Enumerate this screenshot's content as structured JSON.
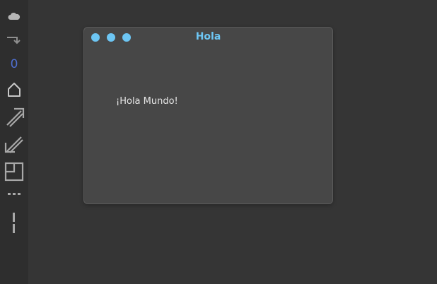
{
  "sidebar": {
    "icons": [
      "cloud-icon",
      "redo-arrow-icon",
      "badge-counter",
      "home-icon",
      "maximize-arrow-icon",
      "minimize-arrow-icon",
      "layout-icon",
      "dash-line-icon",
      "vertical-line-icon"
    ],
    "badge_value": "0"
  },
  "window": {
    "title": "Hola",
    "message": "¡Hola Mundo!"
  },
  "colors": {
    "accent": "#6dc6f4",
    "badge": "#4f6fd0",
    "background": "#353535",
    "sidebar": "#2e2e2e",
    "window_bg": "#474747",
    "icon": "#a8a8a8"
  }
}
